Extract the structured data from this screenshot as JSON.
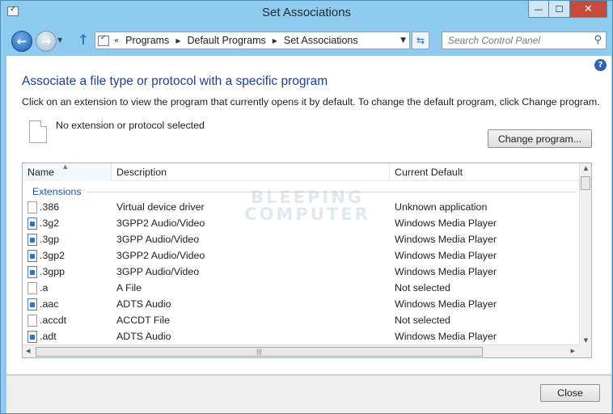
{
  "window": {
    "title": "Set Associations",
    "minimize_glyph": "—",
    "maximize_glyph": "☐",
    "close_glyph": "✕"
  },
  "nav": {
    "back_glyph": "←",
    "forward_glyph": "→",
    "recent_glyph": "▼",
    "up_glyph": "↑",
    "address_chevron": "«",
    "breadcrumbs": [
      "Programs",
      "Default Programs",
      "Set Associations"
    ],
    "crumb_separator": "▶",
    "dropdown_glyph": "▼",
    "refresh_glyph": "⇆",
    "search_placeholder": "Search Control Panel",
    "search_icon_glyph": "⚲"
  },
  "content": {
    "help_glyph": "?",
    "heading": "Associate a file type or protocol with a specific program",
    "instructions": "Click on an extension to view the program that currently opens it by default. To change the default program, click Change program.",
    "selected_text": "No extension or protocol selected",
    "change_button": "Change program..."
  },
  "list": {
    "columns": {
      "name": "Name",
      "description": "Description",
      "current_default": "Current Default"
    },
    "sort_glyph": "▲",
    "group_label": "Extensions",
    "rows": [
      {
        "name": ".386",
        "description": "Virtual device driver",
        "default": "Unknown application",
        "icon": "file-icon"
      },
      {
        "name": ".3g2",
        "description": "3GPP2 Audio/Video",
        "default": "Windows Media Player",
        "icon": "media-file-icon"
      },
      {
        "name": ".3gp",
        "description": "3GPP Audio/Video",
        "default": "Windows Media Player",
        "icon": "media-file-icon"
      },
      {
        "name": ".3gp2",
        "description": "3GPP2 Audio/Video",
        "default": "Windows Media Player",
        "icon": "media-file-icon"
      },
      {
        "name": ".3gpp",
        "description": "3GPP Audio/Video",
        "default": "Windows Media Player",
        "icon": "media-file-icon"
      },
      {
        "name": ".a",
        "description": "A File",
        "default": "Not selected",
        "icon": "file-icon"
      },
      {
        "name": ".aac",
        "description": "ADTS Audio",
        "default": "Windows Media Player",
        "icon": "media-file-icon"
      },
      {
        "name": ".accdt",
        "description": "ACCDT File",
        "default": "Not selected",
        "icon": "file-icon"
      },
      {
        "name": ".adt",
        "description": "ADTS Audio",
        "default": "Windows Media Player",
        "icon": "media-file-icon"
      }
    ],
    "scroll": {
      "up_glyph": "▲",
      "down_glyph": "▼",
      "left_glyph": "◀",
      "right_glyph": "▶",
      "grip_glyph": "|||"
    }
  },
  "watermark": {
    "line1": "BLEEPING",
    "line2": "COMPUTER"
  },
  "footer": {
    "close_button": "Close"
  },
  "colors": {
    "heading": "#1b3f9c",
    "group_label": "#1b56b5",
    "chrome": "#8fcbee",
    "close_button": "#c74a3a"
  }
}
